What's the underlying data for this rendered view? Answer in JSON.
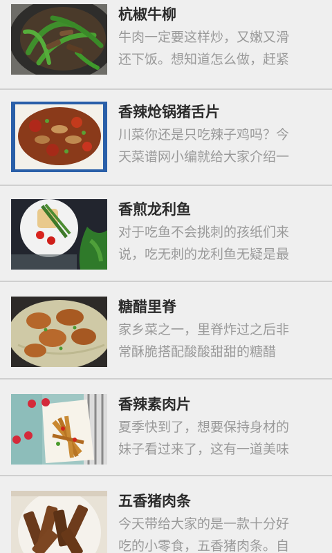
{
  "recipes": [
    {
      "title": "杭椒牛柳",
      "desc": "牛肉一定要这样炒，又嫩又滑还下饭。想知道怎么做，赶紧接着",
      "image": "green-pepper-beef-photo"
    },
    {
      "title": "香辣炝锅猪舌片",
      "desc": "川菜你还是只吃辣子鸡吗？今天菜谱网小编就给大家介绍一款风",
      "image": "spicy-pork-tongue-photo"
    },
    {
      "title": "香煎龙利鱼",
      "desc": "对于吃鱼不会挑刺的孩纸们来说，吃无刺的龙利鱼无疑是最好",
      "image": "pan-fried-sole-photo"
    },
    {
      "title": "糖醋里脊",
      "desc": "家乡菜之一，里脊炸过之后非常酥脆搭配酸酸甜甜的糖醋汁。简",
      "image": "sweet-sour-pork-photo"
    },
    {
      "title": "香辣素肉片",
      "desc": "夏季快到了，想要保持身材的妹子看过来了，这有一道美味的素",
      "image": "spicy-veggie-meat-photo"
    },
    {
      "title": "五香猪肉条",
      "desc": "今天带给大家的是一款十分好吃的小零食，五香猪肉条。自己在",
      "image": "five-spice-pork-strips-photo"
    }
  ]
}
